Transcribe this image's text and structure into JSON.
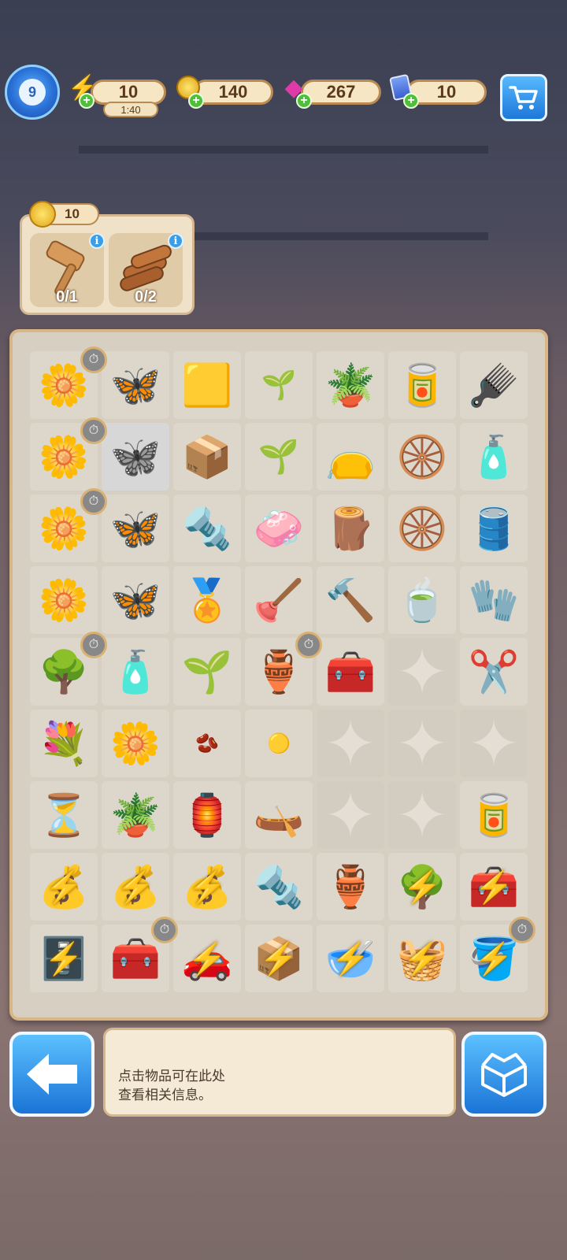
{
  "level": "9",
  "resources": {
    "energy": {
      "value": "10",
      "timer": "1:40",
      "icon": "lightning-icon"
    },
    "coins": {
      "value": "140",
      "icon": "coin-icon"
    },
    "gems": {
      "value": "267",
      "icon": "gem-icon"
    },
    "tickets": {
      "value": "10",
      "icon": "card-icon"
    }
  },
  "order": {
    "reward_coins": "10",
    "requirements": [
      {
        "item": "wooden-mallet",
        "progress": "0/1"
      },
      {
        "item": "log-bundle",
        "progress": "0/2"
      }
    ]
  },
  "board": {
    "rows": [
      [
        "flower-basket",
        "orange-butterfly",
        "cloth-bundle",
        "sprout",
        "clay-pot",
        "paint-can",
        "scrub-brush"
      ],
      [
        "flower-basket",
        "white-butterfly",
        "screw-box",
        "small-tree",
        "blue-sack",
        "wheels",
        "soap-bottle"
      ],
      [
        "flower-basket",
        "blue-butterfly",
        "bolts",
        "soap-bars",
        "wood-chips",
        "wheel",
        "barrel"
      ],
      [
        "flower-basket",
        "monarch-butterfly",
        "locket",
        "plunger",
        "hammer",
        "moss-pot",
        "gloves"
      ],
      [
        "bonsai-tree",
        "lotion-bottle",
        "seedling",
        "vase",
        "toolbox-brown",
        "",
        "pruning-shears"
      ],
      [
        "white-flowers",
        "white-flower-pot",
        "seeds",
        "gold-seeds",
        "",
        "",
        ""
      ],
      [
        "hourglass",
        "potted-plant",
        "lantern",
        "clay-boat",
        "",
        "",
        "paint-tin"
      ],
      [
        "energy-sack",
        "energy-sack",
        "energy-sack",
        "screw",
        "broken-pot",
        "energy-tree",
        "energy-toolbox"
      ],
      [
        "energy-cabinet",
        "red-toolbox",
        "energy-car",
        "energy-crate",
        "energy-bowl",
        "energy-basket",
        "energy-bucket"
      ]
    ]
  },
  "info_panel": {
    "line1": "点击物品可在此处",
    "line2": "查看相关信息。"
  }
}
